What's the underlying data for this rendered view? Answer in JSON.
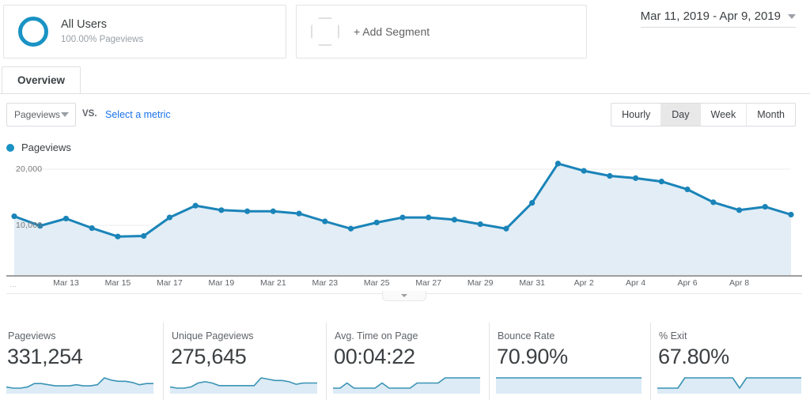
{
  "segments": {
    "all_users": {
      "title": "All Users",
      "subtitle": "100.00% Pageviews",
      "icon": "donut-ring-icon"
    },
    "add_segment": {
      "label": "+ Add Segment",
      "icon": "octagon-outline-icon"
    }
  },
  "date_range": {
    "value": "Mar 11, 2019 - Apr 9, 2019",
    "icon": "caret-down-icon"
  },
  "tabs": [
    {
      "label": "Overview",
      "active": true
    }
  ],
  "metric_controls": {
    "primary_metric": "Pageviews",
    "primary_metric_caret": "caret-down-icon",
    "vs_label": "VS.",
    "secondary_metric_link": "Select a metric",
    "granularity": [
      {
        "label": "Hourly",
        "active": false
      },
      {
        "label": "Day",
        "active": true
      },
      {
        "label": "Week",
        "active": false
      },
      {
        "label": "Month",
        "active": false
      }
    ]
  },
  "legend": [
    {
      "label": "Pageviews",
      "color": "#1a93c4"
    }
  ],
  "colors": {
    "line": "#1a84b8",
    "marker": "#1a84b8",
    "fill": "#ddeaf4",
    "link": "#1a73e8",
    "accent": "#1a93c4"
  },
  "chart_data": {
    "type": "line",
    "title": "Pageviews",
    "xlabel": "",
    "ylabel": "Pageviews",
    "ylim": [
      0,
      25000
    ],
    "grid": true,
    "gridlines": [
      10000,
      20000
    ],
    "ytick_labels": [
      "10,000",
      "20,000"
    ],
    "legend_position": "top-left",
    "x": [
      "Mar 11",
      "Mar 12",
      "Mar 13",
      "Mar 14",
      "Mar 15",
      "Mar 16",
      "Mar 17",
      "Mar 18",
      "Mar 19",
      "Mar 20",
      "Mar 21",
      "Mar 22",
      "Mar 23",
      "Mar 24",
      "Mar 25",
      "Mar 26",
      "Mar 27",
      "Mar 28",
      "Mar 29",
      "Mar 30",
      "Mar 31",
      "Apr 1",
      "Apr 2",
      "Apr 3",
      "Apr 4",
      "Apr 5",
      "Apr 6",
      "Apr 7",
      "Apr 8",
      "Apr 9"
    ],
    "xtick_labels": [
      "Mar 13",
      "Mar 15",
      "Mar 17",
      "Mar 19",
      "Mar 21",
      "Mar 23",
      "Mar 25",
      "Mar 27",
      "Mar 29",
      "Mar 31",
      "Apr 2",
      "Apr 4",
      "Apr 6",
      "Apr 8"
    ],
    "series": [
      {
        "name": "Pageviews",
        "color": "#1a84b8",
        "values": [
          11600,
          9900,
          11200,
          9500,
          8000,
          8100,
          11400,
          13500,
          12700,
          12500,
          12500,
          12100,
          10700,
          9400,
          10500,
          11400,
          11400,
          11000,
          10200,
          9400,
          14000,
          21000,
          19700,
          18800,
          18400,
          17800,
          16400,
          14100,
          12700,
          13300,
          11900
        ]
      }
    ]
  },
  "kpis": [
    {
      "label": "Pageviews",
      "value": "331,254",
      "spark": [
        10,
        9,
        9,
        10,
        13,
        13,
        12,
        11,
        11,
        11,
        12,
        11,
        11,
        12,
        18,
        16,
        15,
        15,
        14,
        12,
        13,
        13
      ]
    },
    {
      "label": "Unique Pageviews",
      "value": "275,645",
      "spark": [
        10,
        9,
        9,
        10,
        13,
        14,
        13,
        11,
        11,
        11,
        11,
        11,
        11,
        17,
        16,
        15,
        15,
        14,
        12,
        13,
        13,
        13
      ]
    },
    {
      "label": "Avg. Time on Page",
      "value": "00:04:22",
      "spark": [
        11,
        11,
        12,
        11,
        11,
        11,
        11,
        12,
        11,
        11,
        11,
        11,
        12,
        12,
        12,
        12,
        13,
        13,
        13,
        13,
        13,
        13
      ]
    },
    {
      "label": "Bounce Rate",
      "value": "70.90%",
      "spark": [
        12,
        12,
        12,
        12,
        12,
        12,
        12,
        12,
        12,
        12,
        12,
        12,
        12,
        12,
        12,
        12,
        12,
        12,
        12,
        12,
        12,
        12
      ]
    },
    {
      "label": "% Exit",
      "value": "67.80%",
      "spark": [
        12,
        12,
        12,
        12,
        13,
        13,
        13,
        13,
        13,
        13,
        13,
        13,
        12,
        13,
        13,
        13,
        13,
        13,
        13,
        13,
        13,
        13
      ]
    }
  ]
}
